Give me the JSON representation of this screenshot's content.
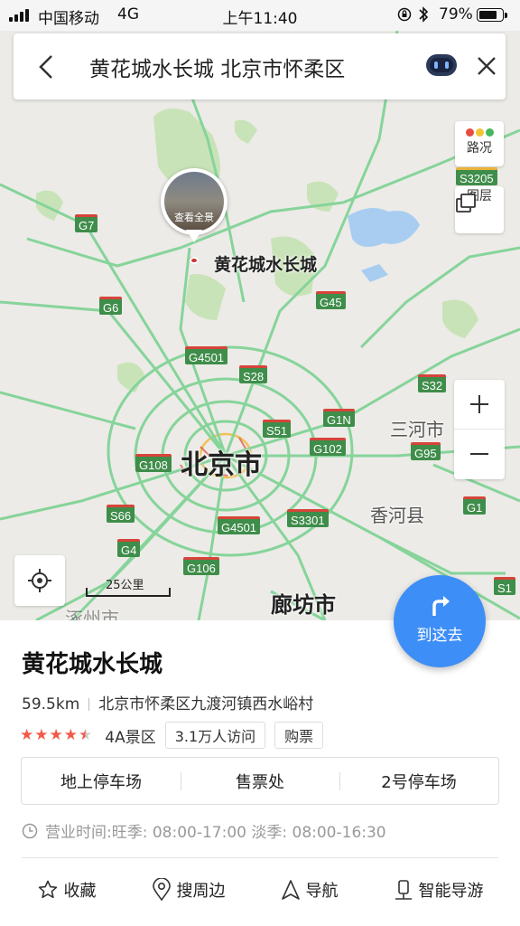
{
  "status_bar": {
    "carrier": "中国移动",
    "network": "4G",
    "time": "上午11:40",
    "battery_pct": "79%",
    "battery_level": 0.79
  },
  "search": {
    "query": "黄花城水长城 北京市怀柔区"
  },
  "map_controls": {
    "traffic_label": "路况",
    "layers_label": "图层",
    "zoom_in": "+",
    "zoom_out": "−",
    "scale_label": "25公里",
    "traffic_colors": [
      "#e84b3d",
      "#f4c331",
      "#45b75c"
    ]
  },
  "poi_marker": {
    "photo_caption": "查看全景",
    "name": "黄花城水长城"
  },
  "road_labels": [
    "G7",
    "G6",
    "S3205",
    "G45",
    "G4501",
    "S28",
    "S32",
    "S51",
    "G1N",
    "G102",
    "G108",
    "G95",
    "S66",
    "G4501",
    "S3301",
    "G1",
    "G4",
    "G106",
    "S1"
  ],
  "cities": {
    "beijing": "北京市",
    "sanhe": "三河市",
    "xianghe": "香河县",
    "langfang": "廊坊市",
    "zhuozhou": "涿州市"
  },
  "go_button": {
    "label": "到这去"
  },
  "place": {
    "title": "黄花城水长城",
    "distance": "59.5km",
    "address": "北京市怀柔区九渡河镇西水峪村",
    "rating": 4.5,
    "grade": "4A景区",
    "visits": "3.1万人访问",
    "ticket": "购票",
    "facilities": [
      "地上停车场",
      "售票处",
      "2号停车场"
    ],
    "hours": "营业时间:旺季: 08:00-17:00 淡季: 08:00-16:30"
  },
  "actions": [
    {
      "label": "收藏",
      "icon": "star-outline-icon"
    },
    {
      "label": "搜周边",
      "icon": "location-pin-icon"
    },
    {
      "label": "导航",
      "icon": "navigation-arrow-icon"
    },
    {
      "label": "智能导游",
      "icon": "audio-guide-icon"
    }
  ]
}
